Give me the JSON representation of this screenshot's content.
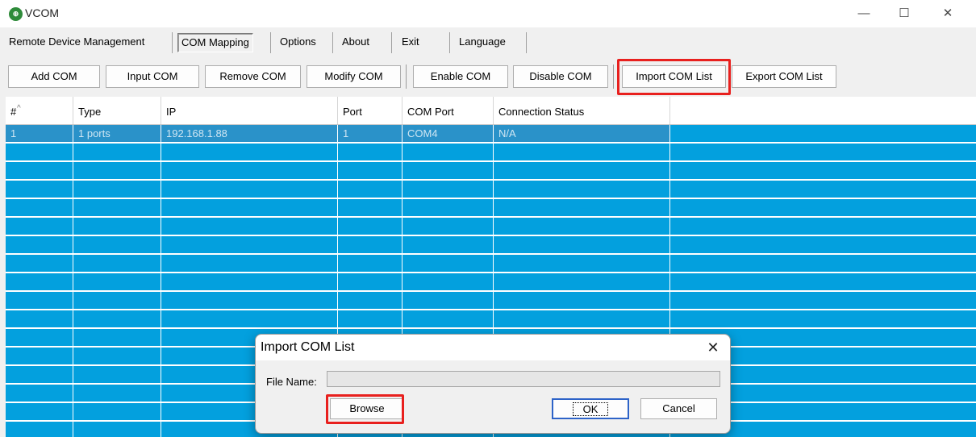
{
  "window": {
    "title": "VCOM",
    "icon": "vcom-globe-icon",
    "minimize": "—",
    "maximize": "☐",
    "close": "✕"
  },
  "menu": {
    "items": [
      "Remote Device Management",
      "COM Mapping",
      "Options",
      "About",
      "Exit",
      "Language"
    ],
    "selected": "COM Mapping"
  },
  "toolbar": {
    "buttons": [
      "Add COM",
      "Input COM",
      "Remove COM",
      "Modify COM",
      "Enable COM",
      "Disable COM",
      "Import COM List",
      "Export COM List"
    ],
    "highlighted": "Import COM List",
    "highlight_color": "#e8201e"
  },
  "table": {
    "sort_indicator": "^",
    "columns": [
      "#",
      "Type",
      "IP",
      "Port",
      "COM Port",
      "Connection Status"
    ],
    "rows": [
      [
        "1",
        "1 ports",
        "192.168.1.88",
        "1",
        "COM4",
        "N/A"
      ]
    ],
    "background_color": "#03a0de",
    "selected_row_color": "#2a92c9"
  },
  "dialog": {
    "title": "Import COM List",
    "close": "✕",
    "file_name_label": "File Name:",
    "file_name_value": "",
    "browse_label": "Browse",
    "ok_label": "OK",
    "cancel_label": "Cancel",
    "highlighted": "Browse"
  }
}
